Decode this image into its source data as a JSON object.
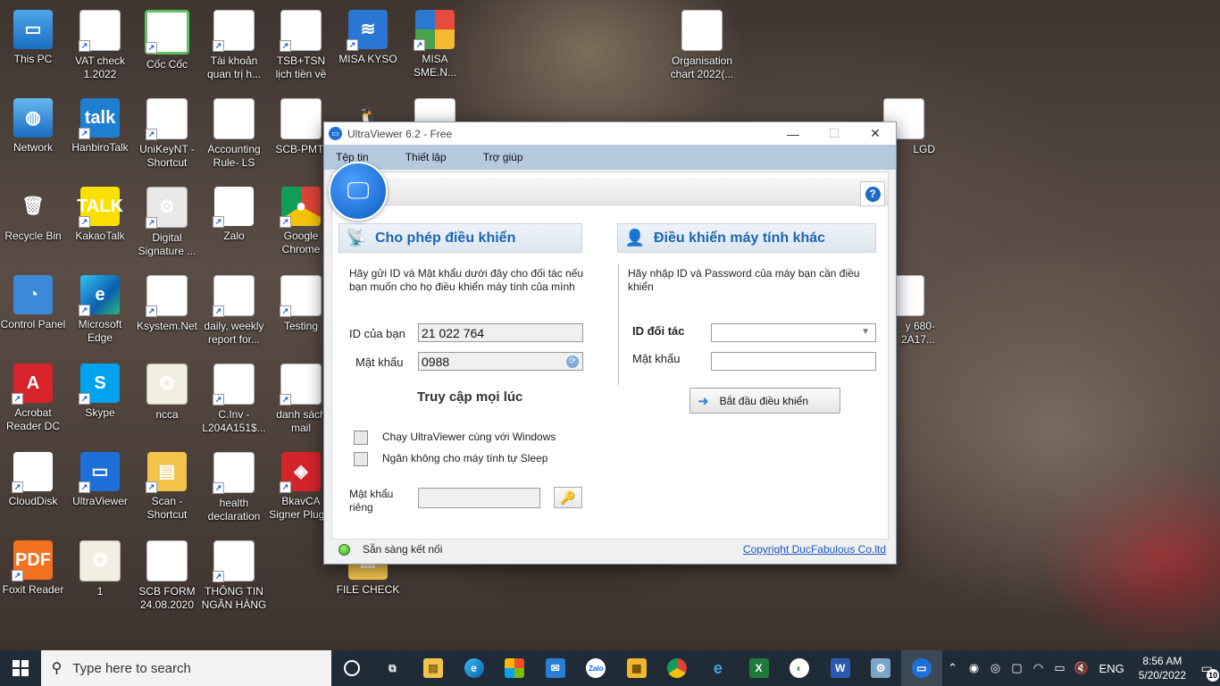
{
  "desktop": {
    "icons": [
      {
        "label": "This PC"
      },
      {
        "label": "VAT check 1.2022"
      },
      {
        "label": "Cốc Cốc"
      },
      {
        "label": "Tài khoản quan trị h..."
      },
      {
        "label": "TSB+TSN lịch tiền về (1)"
      },
      {
        "label": "MISA KYSO"
      },
      {
        "label": "MISA SME.N..."
      },
      {
        "label": "Organisation chart 2022(..."
      },
      {
        "label": "Network"
      },
      {
        "label": "HanbiroTalk"
      },
      {
        "label": "UniKeyNT - Shortcut"
      },
      {
        "label": "Accounting Rule- LS EV..."
      },
      {
        "label": "SCB-PMT-"
      },
      {
        "label": "LGD"
      },
      {
        "label": "Recycle Bin"
      },
      {
        "label": "KakaoTalk"
      },
      {
        "label": "Digital Signature ..."
      },
      {
        "label": "Zalo"
      },
      {
        "label": "Google Chrome"
      },
      {
        "label": "Control Panel"
      },
      {
        "label": "Microsoft Edge"
      },
      {
        "label": "Ksystem.Net"
      },
      {
        "label": "daily, weekly report for..."
      },
      {
        "label": "Testing"
      },
      {
        "label": "y 680- 2A17..."
      },
      {
        "label": "Acrobat Reader DC"
      },
      {
        "label": "Skype"
      },
      {
        "label": "ncca"
      },
      {
        "label": "C.Inv -L204A151$..."
      },
      {
        "label": "danh sách mail"
      },
      {
        "label": "CloudDisk"
      },
      {
        "label": "UltraViewer"
      },
      {
        "label": "Scan - Shortcut"
      },
      {
        "label": "health declaration"
      },
      {
        "label": "BkavCA Signer Plugin"
      },
      {
        "label": "Foxit Reader"
      },
      {
        "label": "1"
      },
      {
        "label": "SCB FORM 24.08.2020"
      },
      {
        "label": "THÔNG TIN NGÂN HÀNG"
      },
      {
        "label": "FILE CHECK"
      }
    ]
  },
  "window": {
    "title": "UltraViewer 6.2 - Free",
    "menu": [
      "Tệp tin",
      "Thiết lập",
      "Trợ giúp"
    ],
    "help_glyph": "?",
    "left": {
      "heading": "Cho phép điều khiển",
      "description": "Hãy gửi ID và Mật khẩu dưới đây cho đối tác nếu bạn muốn cho họ điều khiển máy tính của mình",
      "id_label": "ID của bạn",
      "id_value": "21 022 764",
      "password_label": "Mật khẩu",
      "password_value": "0988"
    },
    "right": {
      "heading": "Điều khiển máy tính khác",
      "description": "Hãy nhập ID và Password của máy bạn cần điều khiển",
      "partner_id_label": "ID đối tác",
      "partner_id_value": "",
      "password_label": "Mật khẩu",
      "password_value": "",
      "start_button": "Bắt đầu điều khiển"
    },
    "anytime": {
      "heading": "Truy cập mọi lúc",
      "option_startup": "Chạy UltraViewer cùng với Windows",
      "option_nosleep": "Ngăn không cho máy tính tự Sleep",
      "private_password_label": "Mật khẩu riêng",
      "private_password_value": ""
    },
    "status": {
      "text": "Sẵn sàng kết nối",
      "color": "#3aa11d",
      "copyright": "Copyright DucFabulous Co.ltd"
    }
  },
  "taskbar": {
    "search_placeholder": "Type here to search",
    "language": "ENG",
    "time": "8:56 AM",
    "date": "5/20/2022",
    "notification_count": "10"
  },
  "colors": {
    "menubar": "#b5c9de",
    "heading_blue": "#1b66b3",
    "taskbar": "#1f2b36"
  }
}
